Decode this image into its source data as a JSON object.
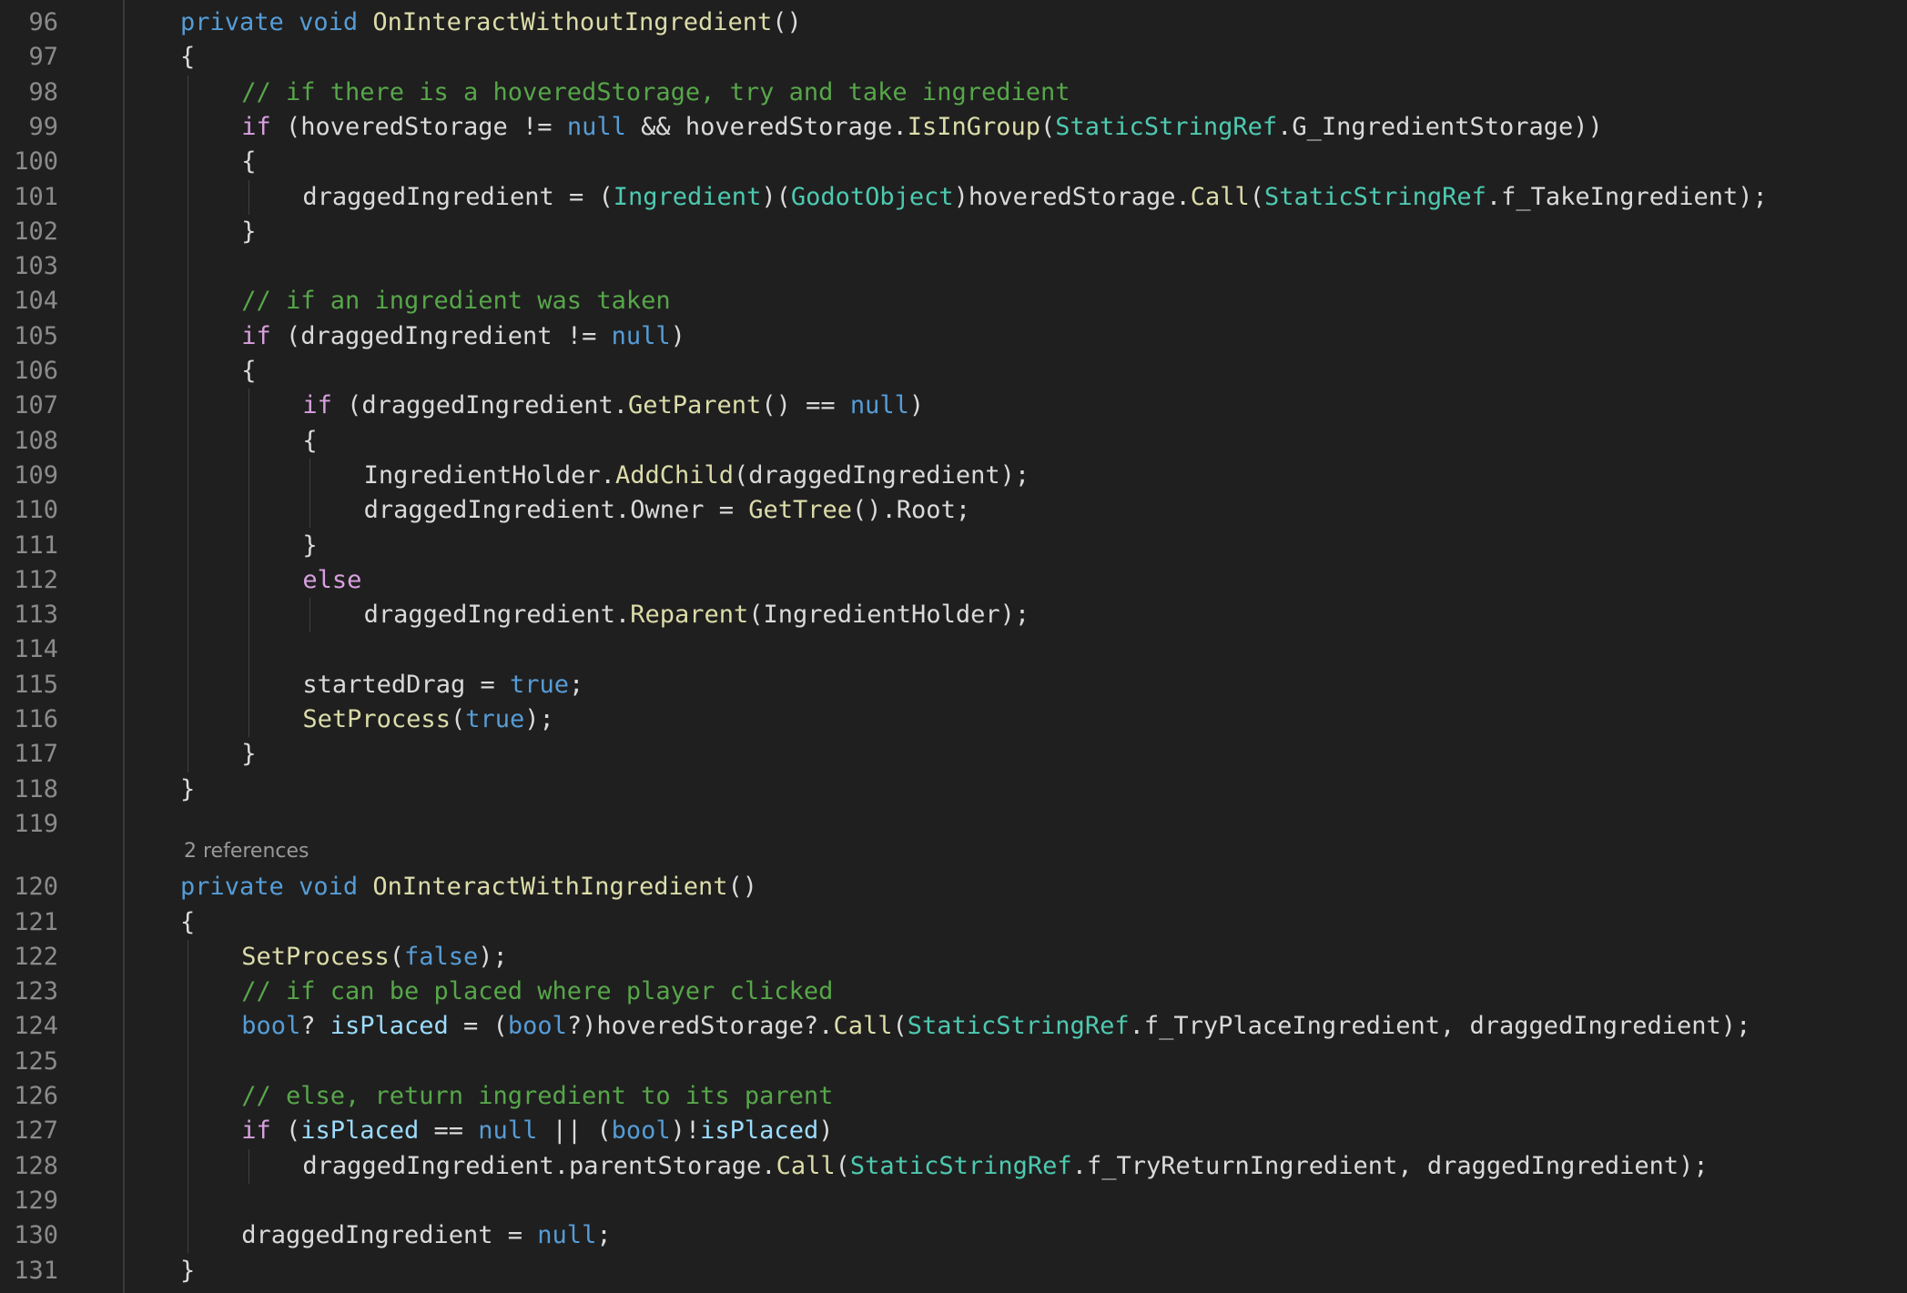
{
  "editor": {
    "codelens": "2 references",
    "lines": [
      {
        "n": "96",
        "indent": 0,
        "tokens": [
          [
            "kw",
            "private"
          ],
          [
            "p",
            " "
          ],
          [
            "kw",
            "void"
          ],
          [
            "p",
            " "
          ],
          [
            "fn",
            "OnInteractWithoutIngredient"
          ],
          [
            "p",
            "()"
          ]
        ]
      },
      {
        "n": "97",
        "indent": 0,
        "tokens": [
          [
            "p",
            "{"
          ]
        ]
      },
      {
        "n": "98",
        "indent": 1,
        "tokens": [
          [
            "cm",
            "// if there is a hoveredStorage, try and take ingredient"
          ]
        ]
      },
      {
        "n": "99",
        "indent": 1,
        "tokens": [
          [
            "ctl",
            "if"
          ],
          [
            "p",
            " (hoveredStorage != "
          ],
          [
            "kw",
            "null"
          ],
          [
            "p",
            " && hoveredStorage."
          ],
          [
            "fn",
            "IsInGroup"
          ],
          [
            "p",
            "("
          ],
          [
            "ty",
            "StaticStringRef"
          ],
          [
            "p",
            ".G_IngredientStorage))"
          ]
        ]
      },
      {
        "n": "100",
        "indent": 1,
        "tokens": [
          [
            "p",
            "{"
          ]
        ]
      },
      {
        "n": "101",
        "indent": 2,
        "tokens": [
          [
            "p",
            "draggedIngredient = ("
          ],
          [
            "ty",
            "Ingredient"
          ],
          [
            "p",
            ")("
          ],
          [
            "ty",
            "GodotObject"
          ],
          [
            "p",
            ")hoveredStorage."
          ],
          [
            "fn",
            "Call"
          ],
          [
            "p",
            "("
          ],
          [
            "ty",
            "StaticStringRef"
          ],
          [
            "p",
            ".f_TakeIngredient);"
          ]
        ]
      },
      {
        "n": "102",
        "indent": 1,
        "tokens": [
          [
            "p",
            "}"
          ]
        ]
      },
      {
        "n": "103",
        "indent": 0,
        "tokens": []
      },
      {
        "n": "104",
        "indent": 1,
        "tokens": [
          [
            "cm",
            "// if an ingredient was taken"
          ]
        ]
      },
      {
        "n": "105",
        "indent": 1,
        "tokens": [
          [
            "ctl",
            "if"
          ],
          [
            "p",
            " (draggedIngredient != "
          ],
          [
            "kw",
            "null"
          ],
          [
            "p",
            ")"
          ]
        ]
      },
      {
        "n": "106",
        "indent": 1,
        "tokens": [
          [
            "p",
            "{"
          ]
        ]
      },
      {
        "n": "107",
        "indent": 2,
        "tokens": [
          [
            "ctl",
            "if"
          ],
          [
            "p",
            " (draggedIngredient."
          ],
          [
            "fn",
            "GetParent"
          ],
          [
            "p",
            "() == "
          ],
          [
            "kw",
            "null"
          ],
          [
            "p",
            ")"
          ]
        ]
      },
      {
        "n": "108",
        "indent": 2,
        "tokens": [
          [
            "p",
            "{"
          ]
        ]
      },
      {
        "n": "109",
        "indent": 3,
        "tokens": [
          [
            "p",
            "IngredientHolder."
          ],
          [
            "fn",
            "AddChild"
          ],
          [
            "p",
            "(draggedIngredient);"
          ]
        ]
      },
      {
        "n": "110",
        "indent": 3,
        "tokens": [
          [
            "p",
            "draggedIngredient.Owner = "
          ],
          [
            "fn",
            "GetTree"
          ],
          [
            "p",
            "().Root;"
          ]
        ]
      },
      {
        "n": "111",
        "indent": 2,
        "tokens": [
          [
            "p",
            "}"
          ]
        ]
      },
      {
        "n": "112",
        "indent": 2,
        "tokens": [
          [
            "ctl",
            "else"
          ]
        ]
      },
      {
        "n": "113",
        "indent": 3,
        "tokens": [
          [
            "p",
            "draggedIngredient."
          ],
          [
            "fn",
            "Reparent"
          ],
          [
            "p",
            "(IngredientHolder);"
          ]
        ]
      },
      {
        "n": "114",
        "indent": 0,
        "tokens": []
      },
      {
        "n": "115",
        "indent": 2,
        "tokens": [
          [
            "p",
            "startedDrag = "
          ],
          [
            "kw",
            "true"
          ],
          [
            "p",
            ";"
          ]
        ]
      },
      {
        "n": "116",
        "indent": 2,
        "tokens": [
          [
            "fn",
            "SetProcess"
          ],
          [
            "p",
            "("
          ],
          [
            "kw",
            "true"
          ],
          [
            "p",
            ");"
          ]
        ]
      },
      {
        "n": "117",
        "indent": 1,
        "tokens": [
          [
            "p",
            "}"
          ]
        ]
      },
      {
        "n": "118",
        "indent": 0,
        "tokens": [
          [
            "p",
            "}"
          ]
        ]
      },
      {
        "n": "119",
        "indent": 0,
        "tokens": []
      },
      {
        "n": "120",
        "indent": 0,
        "tokens": [
          [
            "kw",
            "private"
          ],
          [
            "p",
            " "
          ],
          [
            "kw",
            "void"
          ],
          [
            "p",
            " "
          ],
          [
            "fn",
            "OnInteractWithIngredient"
          ],
          [
            "p",
            "()"
          ]
        ]
      },
      {
        "n": "121",
        "indent": 0,
        "tokens": [
          [
            "p",
            "{"
          ]
        ]
      },
      {
        "n": "122",
        "indent": 1,
        "tokens": [
          [
            "fn",
            "SetProcess"
          ],
          [
            "p",
            "("
          ],
          [
            "kw",
            "false"
          ],
          [
            "p",
            ");"
          ]
        ]
      },
      {
        "n": "123",
        "indent": 1,
        "tokens": [
          [
            "cm",
            "// if can be placed where player clicked"
          ]
        ]
      },
      {
        "n": "124",
        "indent": 1,
        "tokens": [
          [
            "kw",
            "bool"
          ],
          [
            "p",
            "? "
          ],
          [
            "var",
            "isPlaced"
          ],
          [
            "p",
            " = ("
          ],
          [
            "kw",
            "bool"
          ],
          [
            "p",
            "?)hoveredStorage?."
          ],
          [
            "fn",
            "Call"
          ],
          [
            "p",
            "("
          ],
          [
            "ty",
            "StaticStringRef"
          ],
          [
            "p",
            ".f_TryPlaceIngredient, draggedIngredient);"
          ]
        ]
      },
      {
        "n": "125",
        "indent": 0,
        "tokens": []
      },
      {
        "n": "126",
        "indent": 1,
        "tokens": [
          [
            "cm",
            "// else, return ingredient to its parent"
          ]
        ]
      },
      {
        "n": "127",
        "indent": 1,
        "tokens": [
          [
            "ctl",
            "if"
          ],
          [
            "p",
            " ("
          ],
          [
            "var",
            "isPlaced"
          ],
          [
            "p",
            " == "
          ],
          [
            "kw",
            "null"
          ],
          [
            "p",
            " || ("
          ],
          [
            "kw",
            "bool"
          ],
          [
            "p",
            ")!"
          ],
          [
            "var",
            "isPlaced"
          ],
          [
            "p",
            ")"
          ]
        ]
      },
      {
        "n": "128",
        "indent": 2,
        "tokens": [
          [
            "p",
            "draggedIngredient.parentStorage."
          ],
          [
            "fn",
            "Call"
          ],
          [
            "p",
            "("
          ],
          [
            "ty",
            "StaticStringRef"
          ],
          [
            "p",
            ".f_TryReturnIngredient, draggedIngredient);"
          ]
        ]
      },
      {
        "n": "129",
        "indent": 0,
        "tokens": []
      },
      {
        "n": "130",
        "indent": 1,
        "tokens": [
          [
            "p",
            "draggedIngredient = "
          ],
          [
            "kw",
            "null"
          ],
          [
            "p",
            ";"
          ]
        ]
      },
      {
        "n": "131",
        "indent": 0,
        "tokens": [
          [
            "p",
            "}"
          ]
        ]
      }
    ]
  }
}
